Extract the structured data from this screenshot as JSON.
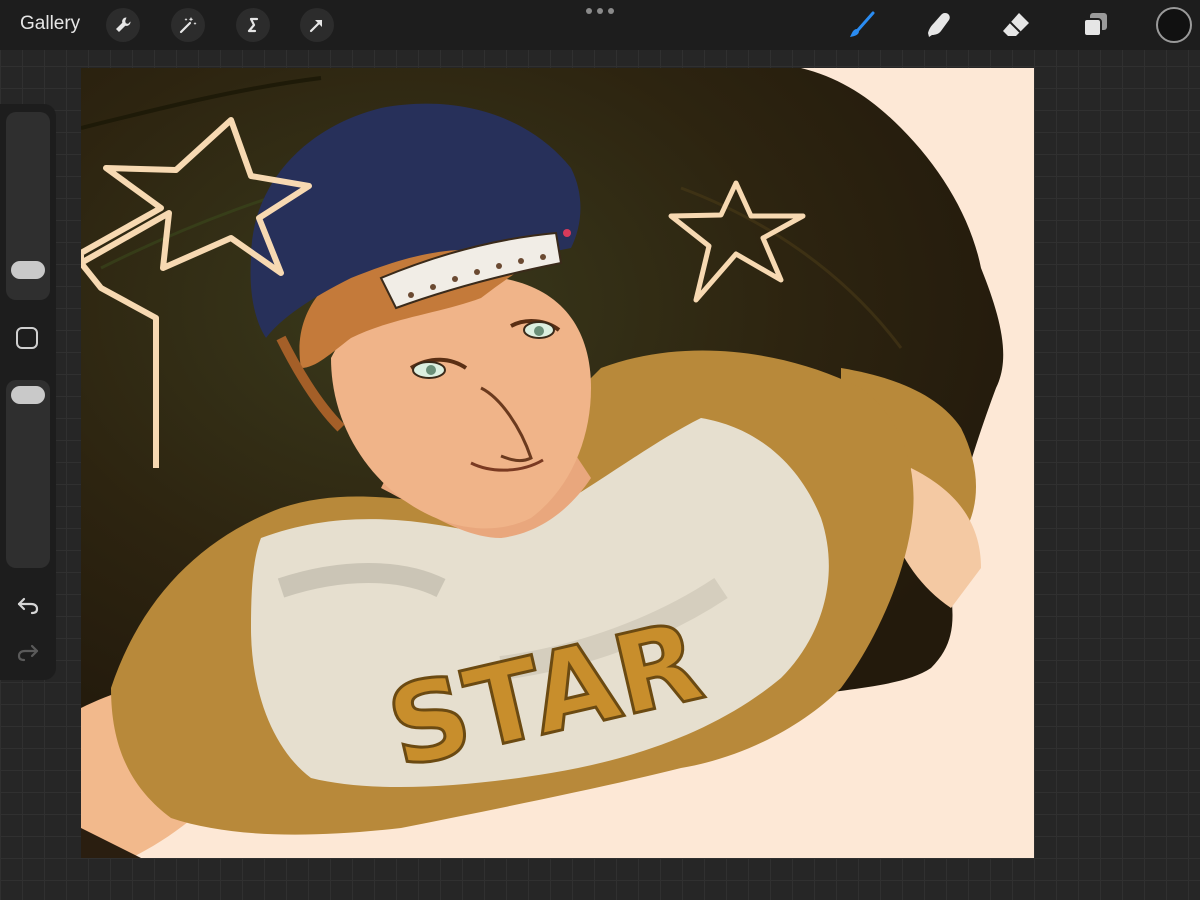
{
  "topbar": {
    "gallery_label": "Gallery",
    "actions": [
      {
        "name": "actions",
        "icon": "wrench-icon"
      },
      {
        "name": "adjustments",
        "icon": "magic-wand-icon"
      },
      {
        "name": "selection",
        "icon": "selection-s-icon"
      },
      {
        "name": "transform",
        "icon": "arrow-cursor-icon"
      }
    ],
    "more_icon": "more-dots-icon",
    "tools": [
      {
        "name": "brush",
        "icon": "brush-icon",
        "active": true
      },
      {
        "name": "smudge",
        "icon": "smudge-finger-icon",
        "active": false
      },
      {
        "name": "eraser",
        "icon": "eraser-icon",
        "active": false
      },
      {
        "name": "layers",
        "icon": "layers-icon",
        "active": false
      }
    ],
    "current_color": "#111111",
    "active_tool_color": "#2a8cf2"
  },
  "sidebar": {
    "brush_size_icon": "brush-size-slider",
    "modify_icon": "square-modify-icon",
    "opacity_icon": "opacity-slider",
    "undo_icon": "undo-arrow-icon",
    "redo_icon": "redo-arrow-icon"
  },
  "canvas": {
    "artwork_text": "STAR",
    "palette": {
      "background": "#fde8d6",
      "dark_bg": "#2e2712",
      "shirt_yellow": "#b8893a",
      "shirt_white": "#e6dfcf",
      "cap_navy": "#27305a",
      "skin": "#f0b489",
      "hair": "#c47a3a",
      "star_outline": "#f7d9b2",
      "lettering": "#c88e2c"
    }
  }
}
